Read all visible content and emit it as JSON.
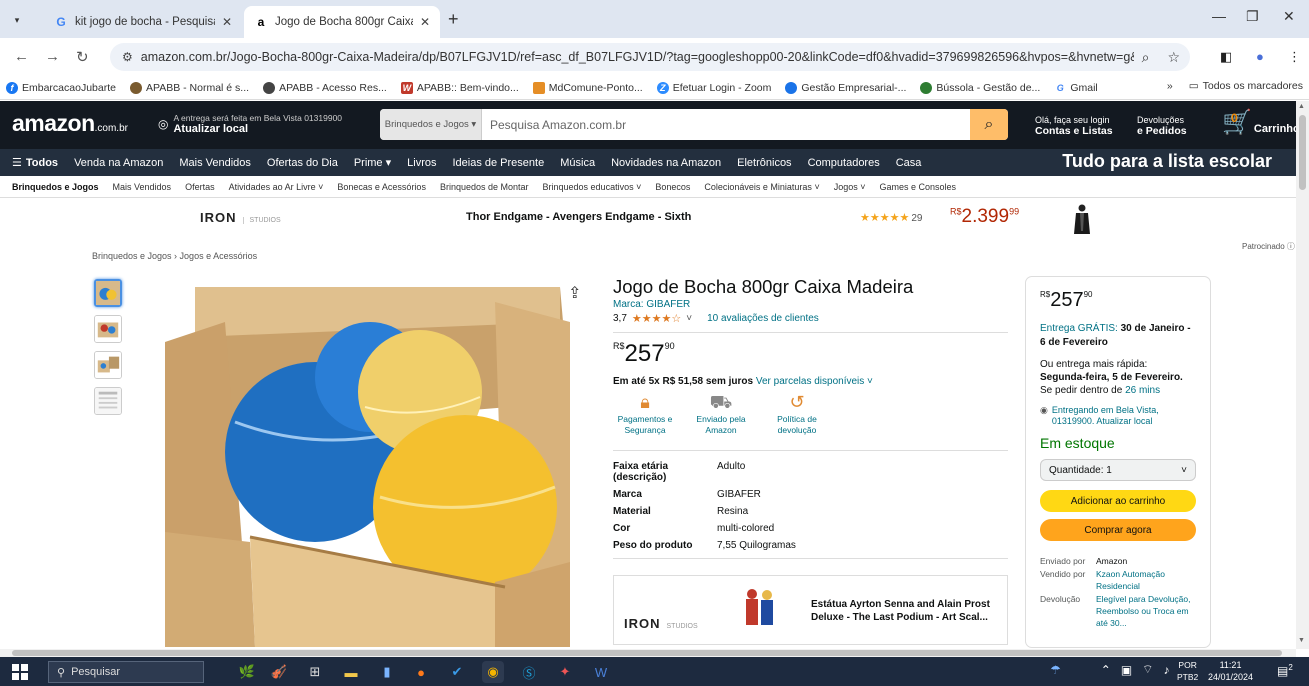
{
  "browser": {
    "tabs": [
      {
        "label": "kit jogo de bocha - Pesquisa Go",
        "favicon": "google-icon",
        "active": false
      },
      {
        "label": "Jogo de Bocha 800gr Caixa Mad",
        "favicon": "amazon-icon",
        "active": true
      }
    ],
    "url": "amazon.com.br/Jogo-Bocha-800gr-Caixa-Madeira/dp/B07LFGJV1D/ref=asc_df_B07LFGJV1D/?tag=googleshopp00-20&linkCode=df0&hvadid=379699826596&hvpos=&hvnetw=g&hvrand=...",
    "bookmarks": [
      {
        "label": "EmbarcacaoJubarte",
        "color": "#1877f2"
      },
      {
        "label": "APABB - Normal é s...",
        "color": "#7a5b2f"
      },
      {
        "label": "APABB - Acesso Res...",
        "color": "#444444"
      },
      {
        "label": "APABB:: Bem-vindo...",
        "color": "#c0392b"
      },
      {
        "label": "MdComune-Ponto...",
        "color": "#e58e26"
      },
      {
        "label": "Efetuar Login - Zoom",
        "color": "#2d8cff"
      },
      {
        "label": "Gestão Empresarial-...",
        "color": "#1a73e8"
      },
      {
        "label": "Bússola - Gestão de...",
        "color": "#2e7d32"
      },
      {
        "label": "Gmail",
        "color": "#4285f4"
      }
    ],
    "bookmarks_more": "»",
    "bookmarks_all": "Todos os marcadores"
  },
  "header": {
    "logo": "amazon",
    "logo_suffix": ".com.br",
    "deliver_line1": "A entrega será feita em Bela Vista 01319900",
    "deliver_line2": "Atualizar local",
    "search_category": "Brinquedos e Jogos",
    "search_placeholder": "Pesquisa Amazon.com.br",
    "account_line1": "Olá, faça seu login",
    "account_line2": "Contas e Listas",
    "orders_line1": "Devoluções",
    "orders_line2": "e Pedidos",
    "cart_count": "0",
    "cart_label": "Carrinho"
  },
  "nav": {
    "all": "Todos",
    "items": [
      "Venda na Amazon",
      "Mais Vendidos",
      "Ofertas do Dia",
      "Prime",
      "Livros",
      "Ideias de Presente",
      "Música",
      "Novidades na Amazon",
      "Eletrônicos",
      "Computadores",
      "Casa"
    ],
    "promo": "Tudo para a lista escolar"
  },
  "subnav": [
    "Brinquedos e Jogos",
    "Mais Vendidos",
    "Ofertas",
    "Atividades ao Ar Livre",
    "Bonecas e Acessórios",
    "Brinquedos de Montar",
    "Brinquedos educativos",
    "Bonecos",
    "Colecionáveis e Miniaturas",
    "Jogos",
    "Games e Consoles"
  ],
  "ad": {
    "brand": "IRON",
    "brand_tag": "STUDIOS",
    "title": "Thor Endgame - Avengers Endgame - Sixth",
    "stars": "★★★★★",
    "reviews": "29",
    "price_currency": "R$",
    "price_whole": "2.399",
    "price_cents": "99",
    "sponsored": "Patrocinado"
  },
  "breadcrumb": "Brinquedos e Jogos › Jogos e Acessórios",
  "product": {
    "title": "Jogo de Bocha 800gr Caixa Madeira",
    "brand": "Marca: GIBAFER",
    "rating": "3,7",
    "stars": "★★★★☆",
    "reviews": "10 avaliações de clientes",
    "price_currency": "R$",
    "price_whole": "257",
    "price_cents": "90",
    "installments": "Em até 5x R$ 51,58 sem juros",
    "installments_link": "Ver parcelas disponíveis",
    "badges": [
      {
        "label": "Pagamentos e Segurança",
        "icon": "lock-icon"
      },
      {
        "label": "Enviado pela Amazon",
        "icon": "truck-icon"
      },
      {
        "label": "Política de devolução",
        "icon": "return-icon"
      }
    ],
    "specs": [
      {
        "k": "Faixa etária (descrição)",
        "v": "Adulto"
      },
      {
        "k": "Marca",
        "v": "GIBAFER"
      },
      {
        "k": "Material",
        "v": "Resina"
      },
      {
        "k": "Cor",
        "v": "multi-colored"
      },
      {
        "k": "Peso do produto",
        "v": "7,55 Quilogramas"
      }
    ],
    "ad_box": {
      "brand": "IRON",
      "brand_tag": "STUDIOS",
      "text": "Estátua Ayrton Senna and Alain Prost Deluxe - The Last Podium - Art Scal..."
    }
  },
  "buybox": {
    "price_currency": "R$",
    "price_whole": "257",
    "price_cents": "90",
    "delivery_prefix": "Entrega GRÁTIS:",
    "delivery_date": "30 de Janeiro - 6 de Fevereiro",
    "fast_prefix": "Ou entrega mais rápida:",
    "fast_date": "Segunda-feira, 5 de Fevereiro.",
    "fast_order": "Se pedir dentro de",
    "fast_time": "26 mins",
    "location": "Entregando em Bela Vista, 01319900. Atualizar local",
    "stock": "Em estoque",
    "quantity": "Quantidade: 1",
    "add_to_cart": "Adicionar ao carrinho",
    "buy_now": "Comprar agora",
    "info": [
      {
        "k": "Enviado por",
        "v": "Amazon"
      },
      {
        "k": "Vendido por",
        "v": "Kzaon Automação Residencial"
      },
      {
        "k": "Devolução",
        "v": "Elegível para Devolução, Reembolso ou Troca em até 30..."
      }
    ]
  },
  "taskbar": {
    "search": "Pesquisar",
    "lang1": "POR",
    "lang2": "PTB2",
    "time": "11:21",
    "date": "24/01/2024",
    "notifications": "2"
  }
}
